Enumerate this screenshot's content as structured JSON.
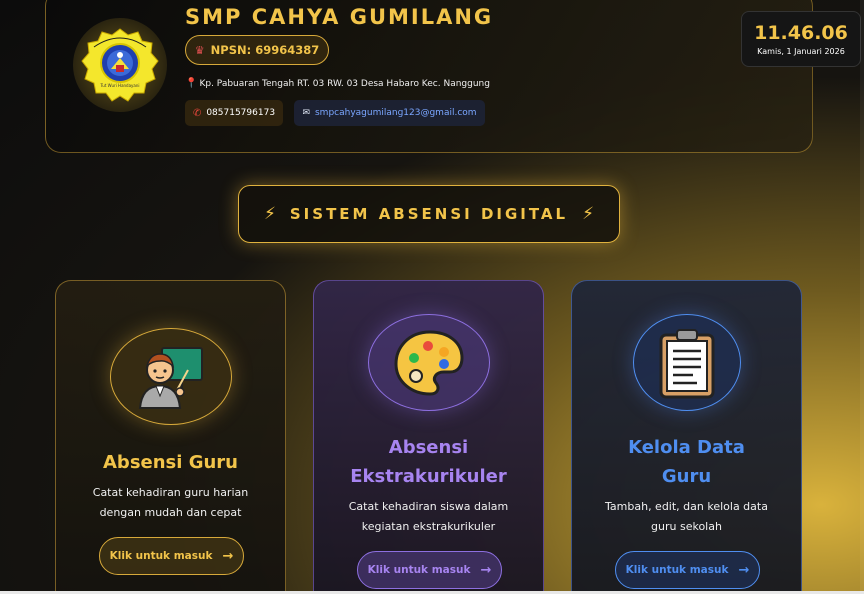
{
  "header": {
    "school_name": "SMP CAHYA GUMILANG",
    "npsn": "NPSN: 69964387",
    "address": "Kp. Pabuaran Tengah RT. 03 RW. 03 Desa Habaro Kec. Nanggung",
    "phone": "085715796173",
    "email": "smpcahyagumilang123@gmail.com",
    "logo_text": "SMP CAHYA GUMILANG"
  },
  "clock": {
    "time": "11.46.06",
    "date": "Kamis, 1 Januari 2026"
  },
  "title": {
    "text": "SISTEM ABSENSI DIGITAL"
  },
  "cards": [
    {
      "title_line1": "Absensi Guru",
      "desc_line1": "Catat kehadiran guru harian",
      "desc_line2": "dengan mudah dan cepat",
      "button": "Klik untuk masuk",
      "icon": "teacher-icon",
      "accent": "#f2c44a"
    },
    {
      "title_line1": "Absensi",
      "title_line2": "Ekstrakurikuler",
      "desc_line1": "Catat kehadiran siswa dalam",
      "desc_line2": "kegiatan ekstrakurikuler",
      "button": "Klik untuk masuk",
      "icon": "palette-icon",
      "accent": "#a784f0"
    },
    {
      "title_line1": "Kelola Data",
      "title_line2": "Guru",
      "desc_line1": "Tambah, edit, dan kelola data",
      "desc_line2": "guru sekolah",
      "button": "Klik untuk masuk",
      "icon": "clipboard-icon",
      "accent": "#4f8ef0"
    }
  ],
  "colors": {
    "gold": "#f2c44a",
    "purple": "#a784f0",
    "blue": "#4f8ef0"
  }
}
